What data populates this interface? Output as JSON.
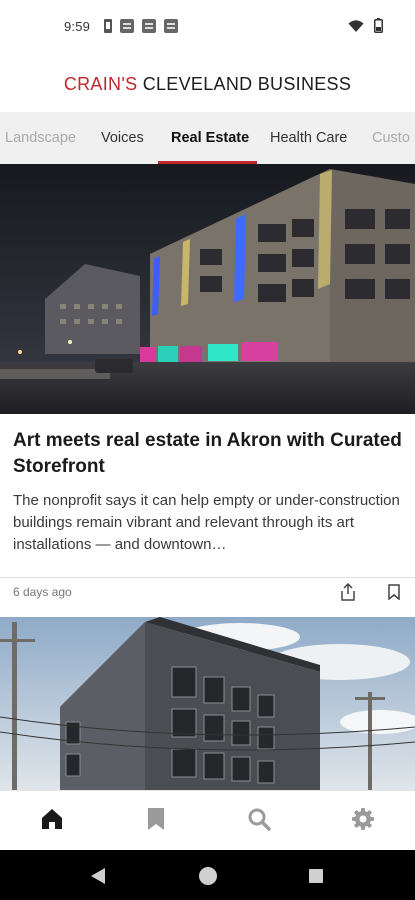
{
  "status_bar": {
    "time": "9:59"
  },
  "masthead": {
    "brand_red": "CRAIN'S",
    "brand_dark": "CLEVELAND BUSINESS"
  },
  "tabs": [
    {
      "label": "Landscape"
    },
    {
      "label": "Voices"
    },
    {
      "label": "Real Estate",
      "active": true
    },
    {
      "label": "Health Care"
    },
    {
      "label": "Custo"
    }
  ],
  "article": {
    "title": "Art meets real estate in Akron with Curated Storefront",
    "summary": "The nonprofit says it can help empty or under-construction buildings remain vibrant and relevant through its art installations — and downtown…",
    "timestamp": "6 days ago"
  },
  "bottom_nav": [
    {
      "icon": "home-icon",
      "active": true
    },
    {
      "icon": "bookmark-icon"
    },
    {
      "icon": "search-icon"
    },
    {
      "icon": "gear-icon"
    }
  ],
  "colors": {
    "brand_red": "#c1272d",
    "tab_bar_bg": "#f0f0f0",
    "active_nav": "#1a1a1a",
    "inactive_nav": "#9a9a9a"
  }
}
